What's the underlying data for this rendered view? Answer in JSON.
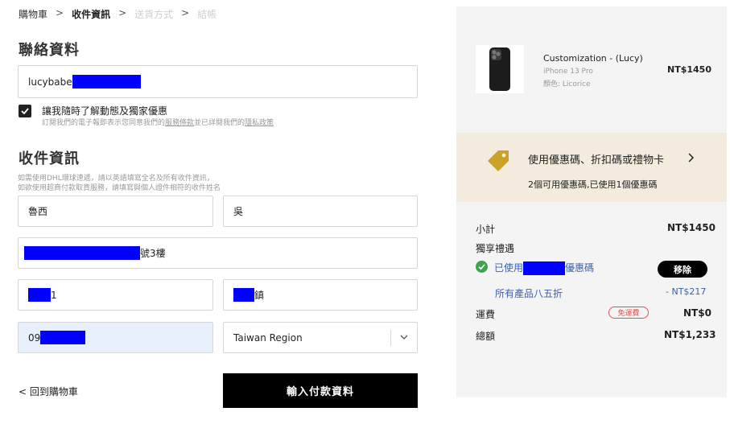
{
  "breadcrumb": {
    "items": [
      "購物車",
      "收件資訊",
      "送貨方式",
      "結帳"
    ],
    "separator": ">"
  },
  "contact": {
    "title": "聯絡資料",
    "email_value": "lucybabe",
    "marketing_label": "讓我隨時了解動態及獨家優惠",
    "marketing_hint_prefix": "訂閱我們的電子報即表示您同意我們的",
    "terms_link": "服務條款",
    "marketing_hint_mid": "並已詳閱我們的",
    "privacy_link": "隱私政策"
  },
  "shipping": {
    "title": "收件資訊",
    "hint_line1": "如需使用DHL環球速遞，請以英語填寫全名及所有收件資訊，",
    "hint_line2": "如欲使用超商付款取貨服務，請填寫與個人證件相符的收件姓名",
    "first_name": "魯西",
    "last_name": "吳",
    "address_suffix": "號3樓",
    "city_suffix": "1",
    "district_suffix": "鎮",
    "phone_prefix": "09",
    "region": "Taiwan Region"
  },
  "actions": {
    "back_label": "< 回到購物車",
    "pay_label": "輸入付款資料"
  },
  "order": {
    "product_name": "Customization - (Lucy)",
    "product_model": "iPhone 13 Pro",
    "product_color": "顏色: Licorice",
    "product_price": "NT$1450"
  },
  "coupon": {
    "link_label": "使用優惠碼、折扣碼或禮物卡",
    "status": "2個可用優惠碼,已使用1個優惠碼"
  },
  "summary": {
    "subtotal_label": "小計",
    "subtotal_value": "NT$1450",
    "exclusive_label": "獨享禮遇",
    "applied_prefix": "已使用",
    "applied_suffix": "優惠碼",
    "remove_label": "移除",
    "discount_label": "所有產品八五折",
    "discount_value": "- NT$217",
    "shipping_label": "運費",
    "shipping_badge": "免運費",
    "shipping_value": "NT$0",
    "total_label": "總額",
    "total_value": "NT$1,233"
  },
  "colors": {
    "accent_green": "#3fa34d",
    "link_blue": "#3a5fb0",
    "badge_red": "#d9534f",
    "redaction": "#0000ff"
  }
}
